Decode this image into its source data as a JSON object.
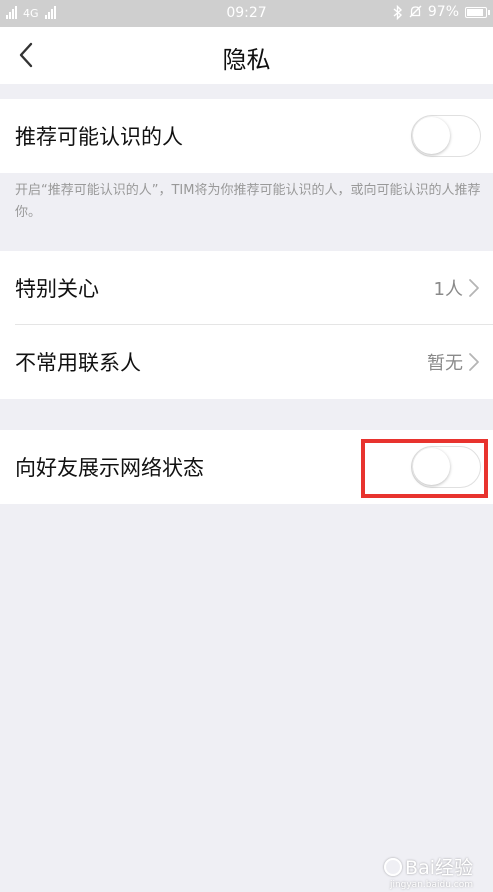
{
  "status_bar": {
    "network": "4G",
    "time": "09:27",
    "battery": "97%",
    "battery_fill": 0.97,
    "icons": [
      "signal-icon",
      "bluetooth-icon",
      "mute-icon",
      "battery-icon"
    ]
  },
  "nav": {
    "title": "隐私",
    "back_icon": "chevron-left-icon"
  },
  "settings": {
    "recommend": {
      "label": "推荐可能认识的人",
      "enabled": false,
      "hint": "开启“推荐可能认识的人”，TIM将为你推荐可能认识的人，或向可能认识的人推荐你。"
    },
    "special_care": {
      "label": "特别关心",
      "value": "1人"
    },
    "infrequent_contacts": {
      "label": "不常用联系人",
      "value": "暂无"
    },
    "show_network_status": {
      "label": "向好友展示网络状态",
      "enabled": false
    }
  },
  "colors": {
    "background": "#efeff4",
    "highlight": "#e8332e",
    "toggle_off_border": "#e0e0e0",
    "secondary_text": "#8a8a8a"
  },
  "watermark": {
    "text": "Bai经验",
    "sub": "jingyan.baidu.com"
  }
}
